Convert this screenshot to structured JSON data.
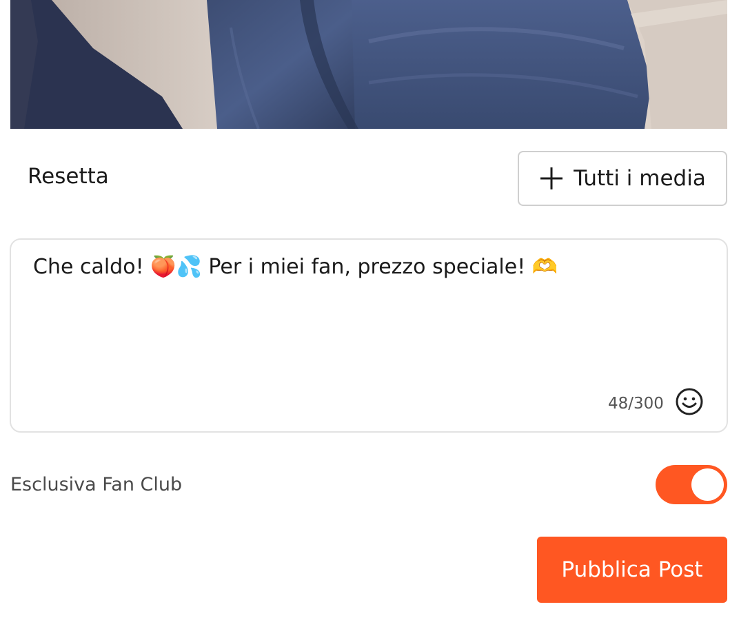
{
  "media": {
    "image_description_icon": "photo-preview"
  },
  "toolbar": {
    "reset_label": "Resetta",
    "all_media_label": "Tutti i media",
    "all_media_icon": "plus-icon"
  },
  "caption": {
    "text": "Che caldo! 🍑💦 Per i miei fan, prezzo speciale! 🫶",
    "counter": "48/300",
    "emoji_icon": "smiley-icon"
  },
  "exclusive": {
    "label": "Esclusiva Fan Club",
    "enabled": true
  },
  "publish": {
    "label": "Pubblica Post"
  },
  "colors": {
    "accent": "#ff5722",
    "border": "#cfcfcf",
    "text": "#1a1a1a",
    "muted": "#555555"
  }
}
